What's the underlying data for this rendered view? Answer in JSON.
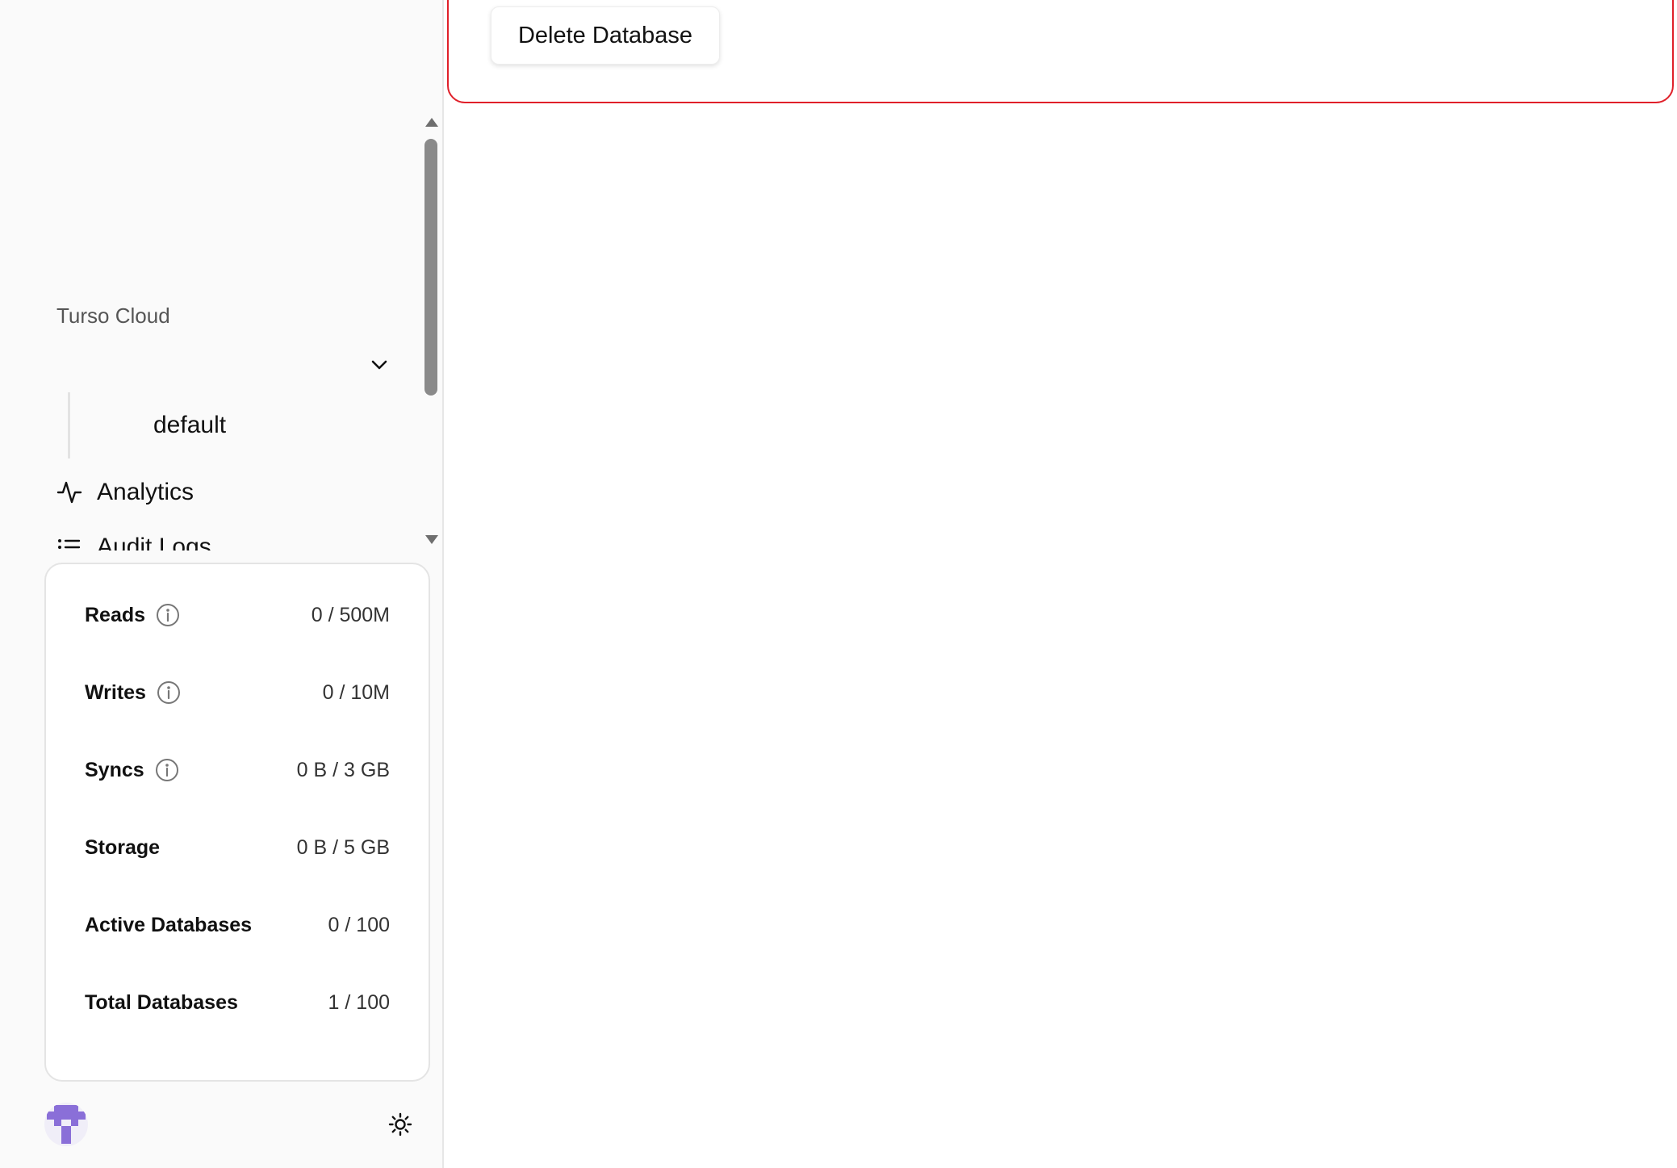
{
  "sidebar": {
    "org_name": "Turso Cloud",
    "org_toggle_icon": "chevron-down-icon",
    "group_item": "default",
    "nav_items": [
      {
        "label": "Analytics",
        "icon": "activity-icon"
      },
      {
        "label": "Audit Logs",
        "icon": "list-icon"
      }
    ],
    "usage": [
      {
        "name": "Reads",
        "value": "0 / 500M",
        "has_info": true
      },
      {
        "name": "Writes",
        "value": "0 / 10M",
        "has_info": true
      },
      {
        "name": "Syncs",
        "value": "0 B / 3 GB",
        "has_info": true
      },
      {
        "name": "Storage",
        "value": "0 B / 5 GB",
        "has_info": false
      },
      {
        "name": "Active Databases",
        "value": "0 / 100",
        "has_info": false
      },
      {
        "name": "Total Databases",
        "value": "1 / 100",
        "has_info": false
      }
    ],
    "footer": {
      "avatar_icon": "user-avatar-icon",
      "theme_icon": "sun-icon"
    }
  },
  "main": {
    "danger_zone": {
      "delete_button_label": "Delete Database"
    }
  },
  "colors": {
    "danger": "#e0202a",
    "sidebar_bg": "#fafafa",
    "avatar_purple": "#8a6fd8"
  }
}
